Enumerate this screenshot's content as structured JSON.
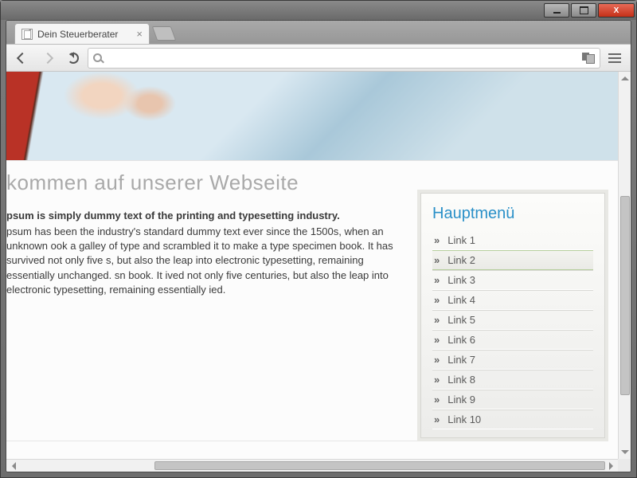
{
  "window": {
    "min_tooltip": "Minimize",
    "max_tooltip": "Maximize",
    "close_label": "X"
  },
  "browser": {
    "tab_title": "Dein Steuerberater",
    "omnibox_value": "",
    "omnibox_placeholder": ""
  },
  "page": {
    "title": "kommen auf unserer Webseite",
    "lead": "psum is simply dummy text of the printing and typesetting industry.",
    "body": "psum has been the industry's standard dummy text ever since the 1500s, when an unknown ook a galley of type and scrambled it to make a type specimen book. It has survived not only five s, but also the leap into electronic typesetting, remaining essentially unchanged. sn book. It ived not only five centuries, but also the leap into electronic typesetting, remaining essentially ied."
  },
  "sidebar": {
    "heading": "Hauptmenü",
    "items": [
      {
        "label": "Link 1"
      },
      {
        "label": "Link 2"
      },
      {
        "label": "Link 3"
      },
      {
        "label": "Link 4"
      },
      {
        "label": "Link 5"
      },
      {
        "label": "Link 6"
      },
      {
        "label": "Link 7"
      },
      {
        "label": "Link 8"
      },
      {
        "label": "Link 9"
      },
      {
        "label": "Link 10"
      }
    ]
  }
}
